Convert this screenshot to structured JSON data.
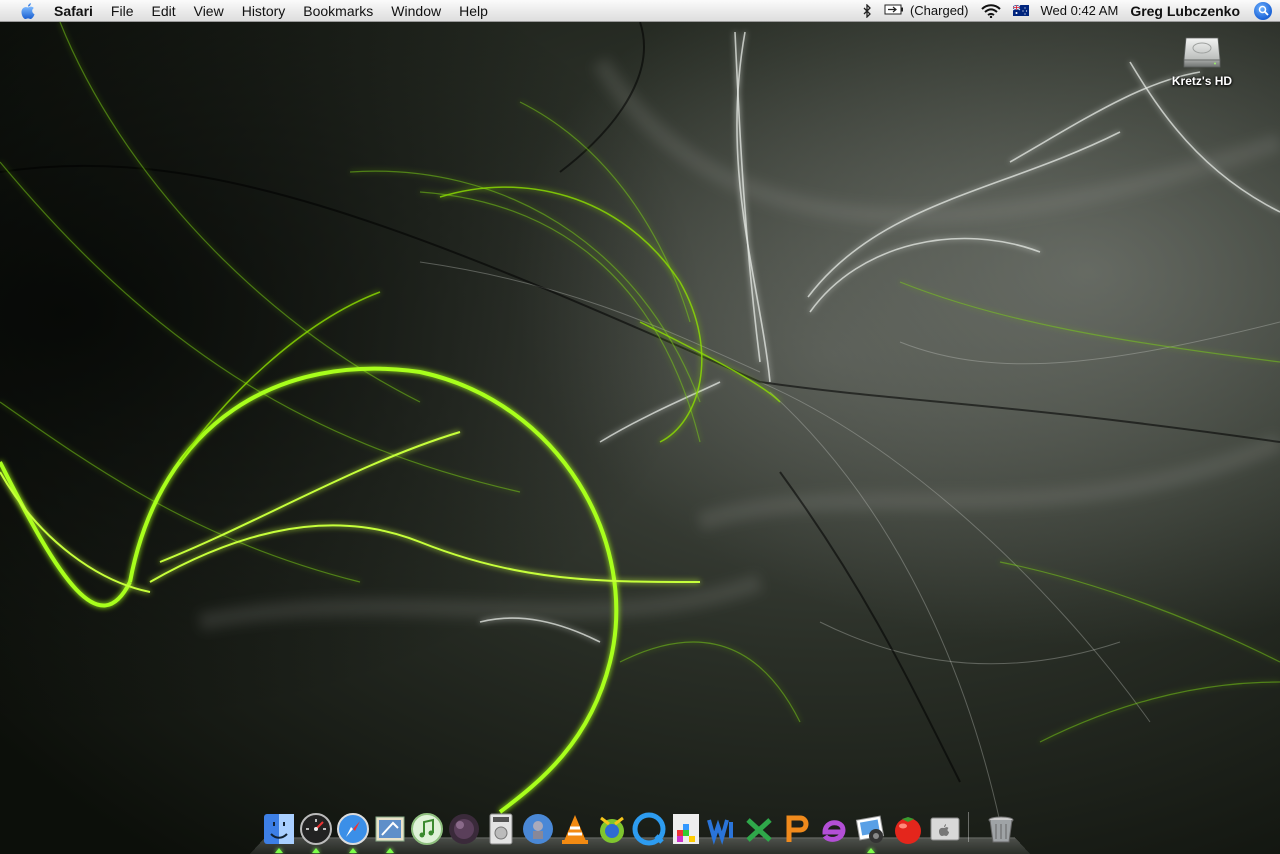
{
  "menubar": {
    "app_name": "Safari",
    "items": [
      "File",
      "Edit",
      "View",
      "History",
      "Bookmarks",
      "Window",
      "Help"
    ],
    "battery_status": "(Charged)",
    "clock": "Wed 0:42 AM",
    "user_name": "Greg Lubczenko",
    "icons": [
      "apple-logo-icon",
      "bluetooth-icon",
      "battery-icon",
      "wifi-icon",
      "australian-flag-icon",
      "spotlight-icon"
    ]
  },
  "desktop": {
    "hd_label": "Kretz's HD",
    "hd_icon": "hard-drive-icon"
  },
  "dock": {
    "items": [
      {
        "name": "finder",
        "running": true
      },
      {
        "name": "dashboard",
        "running": true
      },
      {
        "name": "safari",
        "running": true
      },
      {
        "name": "mail",
        "running": true
      },
      {
        "name": "itunes",
        "running": false
      },
      {
        "name": "dark-orb-app",
        "running": false
      },
      {
        "name": "dvd-player",
        "running": false
      },
      {
        "name": "network-globe-app",
        "running": false
      },
      {
        "name": "vlc",
        "running": false
      },
      {
        "name": "adium",
        "running": false
      },
      {
        "name": "quicktime",
        "running": false
      },
      {
        "name": "tetris-app",
        "running": false
      },
      {
        "name": "word",
        "running": false
      },
      {
        "name": "excel",
        "running": false
      },
      {
        "name": "powerpoint",
        "running": false
      },
      {
        "name": "entourage",
        "running": false
      },
      {
        "name": "iphoto",
        "running": true
      },
      {
        "name": "tomato-app",
        "running": false
      },
      {
        "name": "system-app",
        "running": false
      },
      {
        "name": "trash",
        "running": false
      }
    ]
  },
  "colors": {
    "wallpaper_accent": "#9bf21a",
    "wallpaper_base": "#1a1f17",
    "running_indicator": "#7dff4a"
  }
}
